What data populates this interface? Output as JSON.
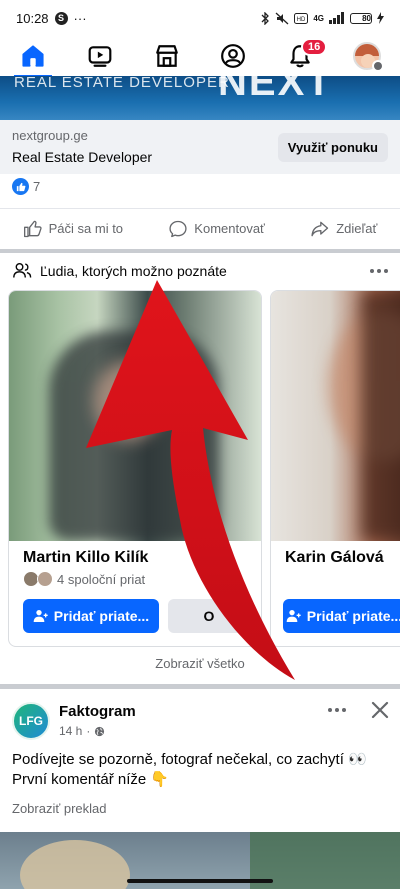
{
  "status_bar": {
    "time": "10:28",
    "app_badge": "S",
    "more": "···",
    "network": "4G",
    "battery": "80"
  },
  "nav": {
    "items": [
      {
        "name": "home",
        "active": true
      },
      {
        "name": "watch"
      },
      {
        "name": "marketplace"
      },
      {
        "name": "profile"
      },
      {
        "name": "notifications",
        "badge": "16"
      },
      {
        "name": "menu"
      }
    ]
  },
  "ad": {
    "banner_text": "REAL ESTATE DEVELOPER",
    "banner_brand": "NEXT",
    "domain": "nextgroup.ge",
    "title": "Real Estate Developer",
    "cta": "Využiť ponuku",
    "reaction_count": "7",
    "actions": {
      "like": "Páči sa mi to",
      "comment": "Komentovať",
      "share": "Zdieľať"
    }
  },
  "pymk": {
    "title": "Ľudia, ktorých možno poznáte",
    "cards": [
      {
        "name": "Martin Killo Kilík",
        "mutual": "4 spoloční priat",
        "add_label": "Pridať priate...",
        "remove_label": "O"
      },
      {
        "name": "Karin Gálová",
        "add_label": "Pridať priate..."
      }
    ],
    "see_all": "Zobraziť všetko"
  },
  "post": {
    "author": "Faktogram",
    "avatar_text": "LFG",
    "time": "14 h",
    "text_line1": "Podívejte se pozorně, fotograf nečekal, co zachytí 👀",
    "text_line2": "První komentář níže 👇",
    "translate": "Zobraziť preklad"
  },
  "colors": {
    "accent": "#0866ff",
    "notification": "#e41e3f",
    "overlay_arrow": "#e0141b"
  }
}
